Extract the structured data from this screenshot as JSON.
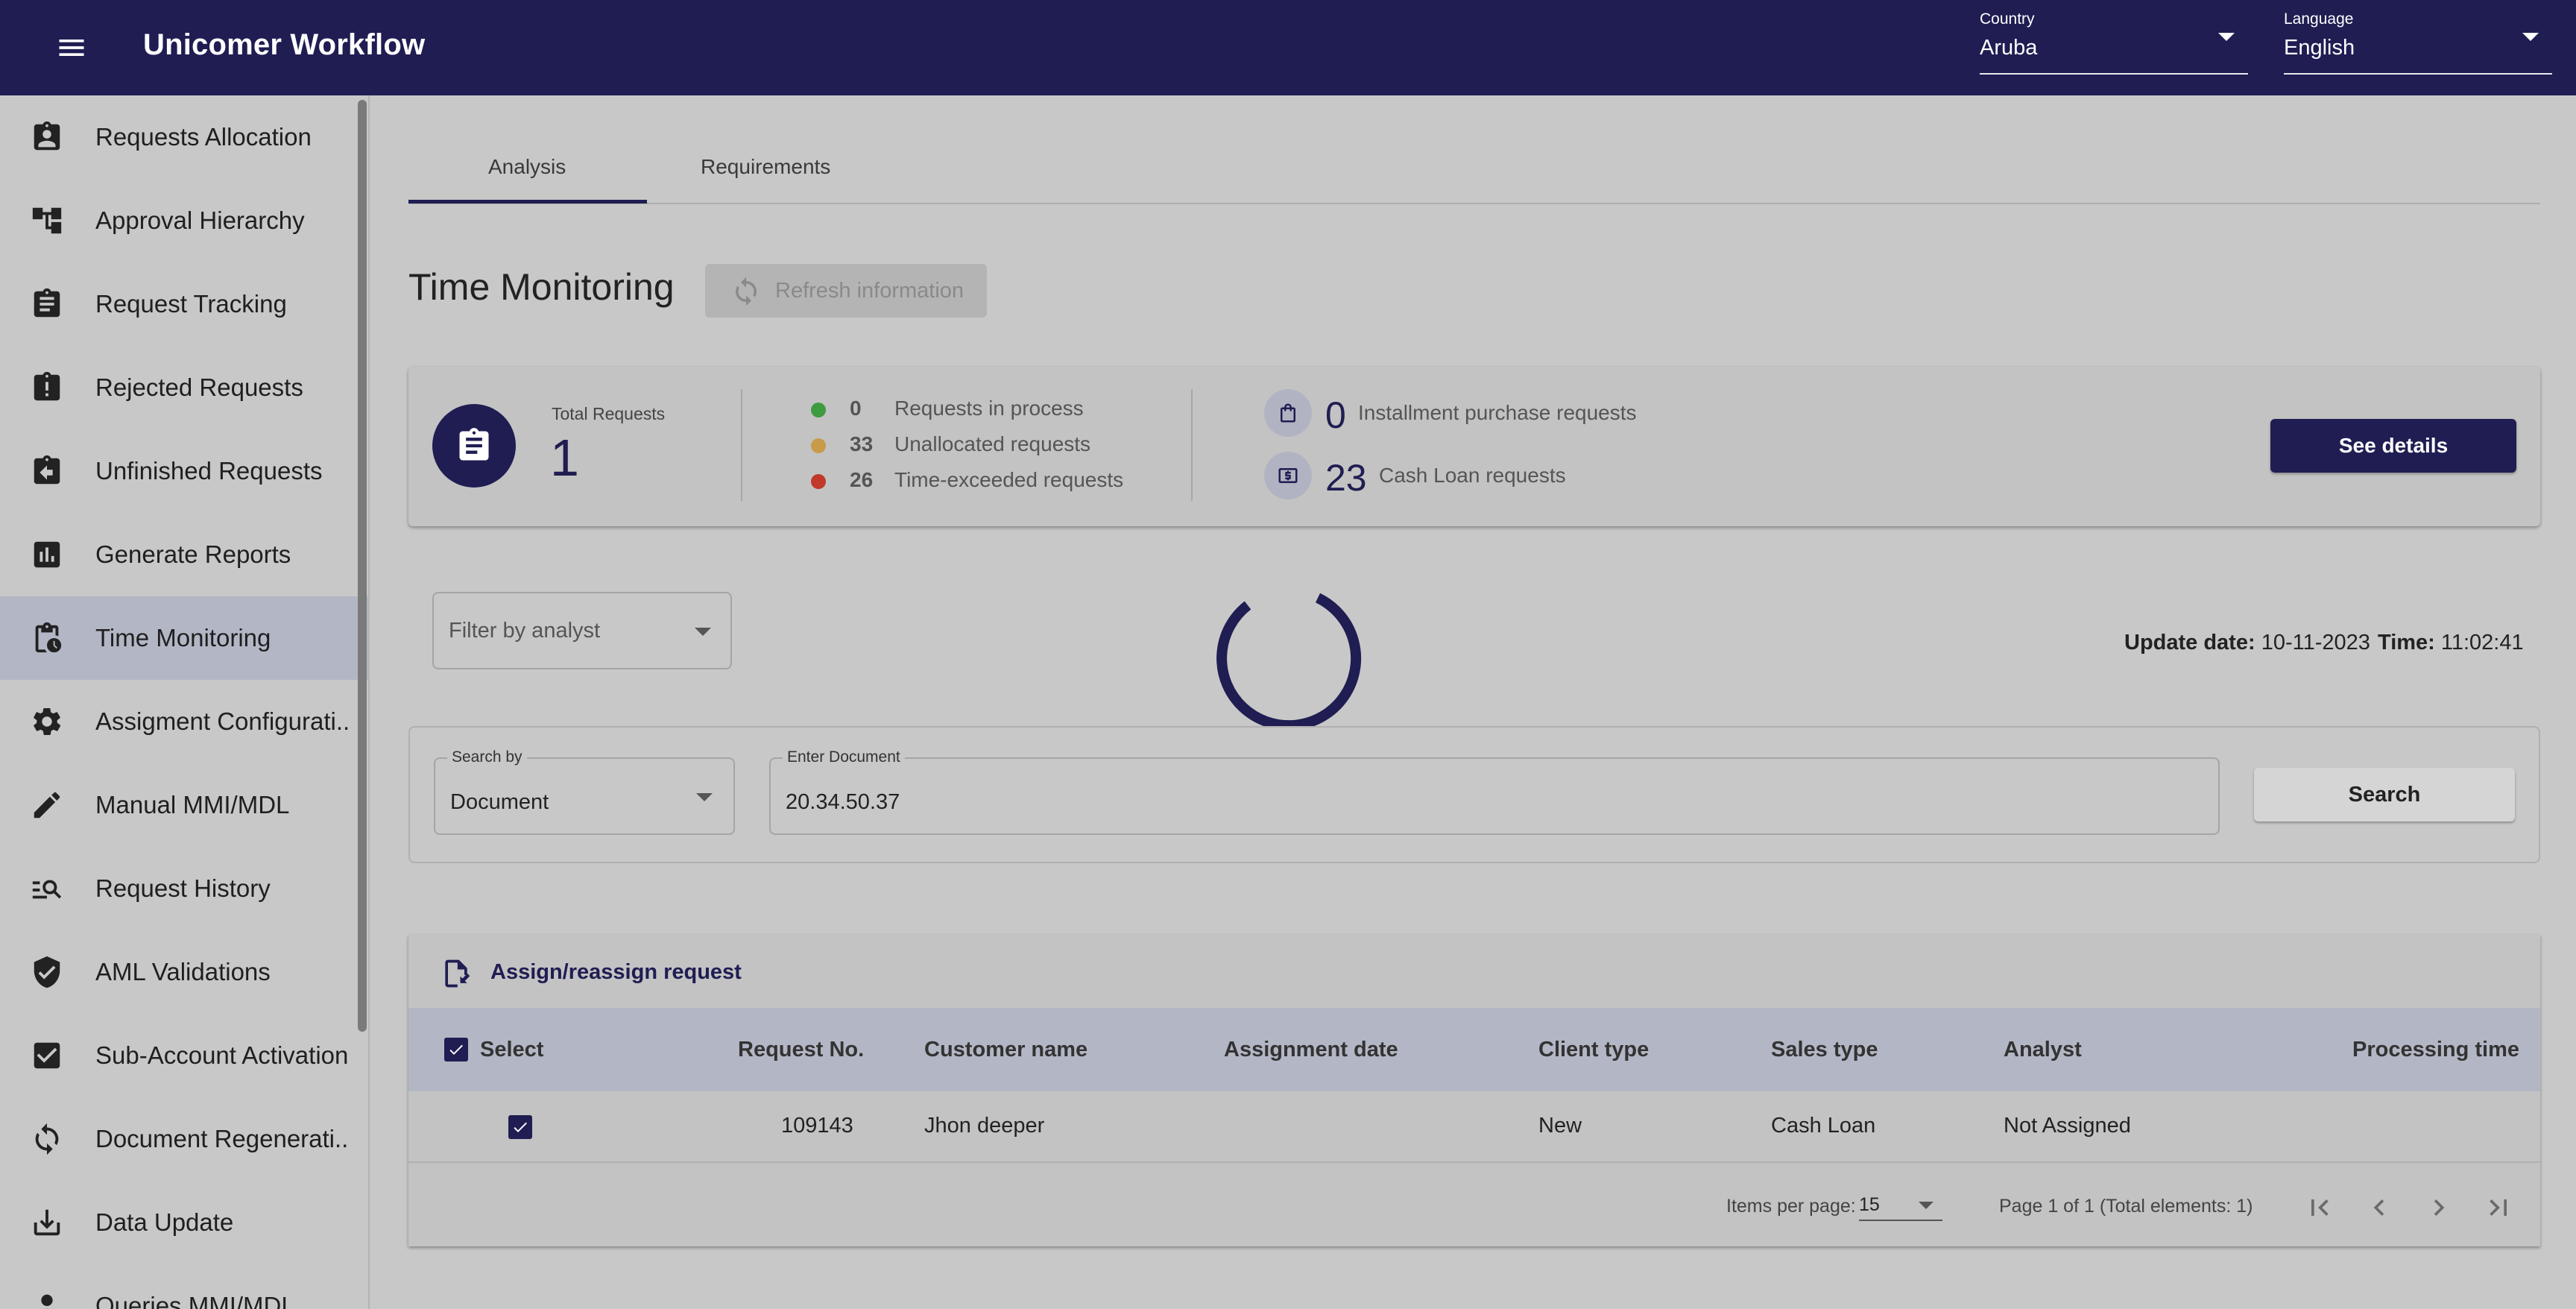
{
  "header": {
    "app_title": "Unicomer Workflow",
    "country": {
      "label": "Country",
      "value": "Aruba"
    },
    "language": {
      "label": "Language",
      "value": "English"
    }
  },
  "sidebar": {
    "items": [
      {
        "label": "Requests Allocation",
        "icon": "assignment-ind-icon"
      },
      {
        "label": "Approval Hierarchy",
        "icon": "account-tree-icon"
      },
      {
        "label": "Request Tracking",
        "icon": "assignment-icon"
      },
      {
        "label": "Rejected Requests",
        "icon": "assignment-late-icon"
      },
      {
        "label": "Unfinished Requests",
        "icon": "assignment-return-icon"
      },
      {
        "label": "Generate Reports",
        "icon": "assessment-icon"
      },
      {
        "label": "Time Monitoring",
        "icon": "pending-actions-icon",
        "active": true
      },
      {
        "label": "Assigment Configurati...",
        "icon": "settings-icon"
      },
      {
        "label": "Manual MMI/MDL",
        "icon": "edit-icon"
      },
      {
        "label": "Request History",
        "icon": "manage-search-icon"
      },
      {
        "label": "AML Validations",
        "icon": "verified-user-icon"
      },
      {
        "label": "Sub-Account Activation",
        "icon": "check-box-icon"
      },
      {
        "label": "Document Regenerati...",
        "icon": "sync-icon"
      },
      {
        "label": "Data Update",
        "icon": "download-icon"
      },
      {
        "label": "Queries MMI/MDL",
        "icon": "person-icon"
      }
    ]
  },
  "tabs": [
    {
      "label": "Analysis",
      "active": true
    },
    {
      "label": "Requirements",
      "active": false
    }
  ],
  "page": {
    "title": "Time Monitoring",
    "refresh_label": "Refresh information"
  },
  "summary": {
    "total_label": "Total Requests",
    "total_value": "1",
    "stats": [
      {
        "count": "0",
        "label": "Requests in process",
        "color": "#3f9b3f"
      },
      {
        "count": "33",
        "label": "Unallocated requests",
        "color": "#c99a4a"
      },
      {
        "count": "26",
        "label": "Time-exceeded requests",
        "color": "#c0392b"
      }
    ],
    "types": [
      {
        "count": "0",
        "label": "Installment purchase requests",
        "icon": "shopping-bag-icon"
      },
      {
        "count": "23",
        "label": "Cash Loan requests",
        "icon": "cash-icon"
      }
    ],
    "see_details": "See details"
  },
  "filter": {
    "placeholder": "Filter by analyst"
  },
  "update": {
    "date_label": "Update date:",
    "date_value": "10-11-2023",
    "time_label": "Time:",
    "time_value": "11:02:41"
  },
  "search": {
    "by_label": "Search by",
    "by_value": "Document",
    "doc_label": "Enter Document",
    "doc_value": "20.34.50.37",
    "button": "Search"
  },
  "table": {
    "title": "Assign/reassign request",
    "columns": [
      "Select",
      "Request No.",
      "Customer name",
      "Assignment date",
      "Client type",
      "Sales type",
      "Analyst",
      "Processing time"
    ],
    "rows": [
      {
        "checked": true,
        "request_no": "109143",
        "customer": "Jhon deeper",
        "assignment_date": "",
        "client_type": "New",
        "sales_type": "Cash Loan",
        "analyst": "Not Assigned",
        "processing_time": ""
      }
    ],
    "pager": {
      "items_per_page_label": "Items per page:",
      "items_per_page": "15",
      "page_info": "Page 1 of 1 (Total elements: 1)"
    }
  },
  "colors": {
    "primary": "#1f1d52",
    "background": "#c8c8c8",
    "active_nav": "#b3b7c5"
  }
}
